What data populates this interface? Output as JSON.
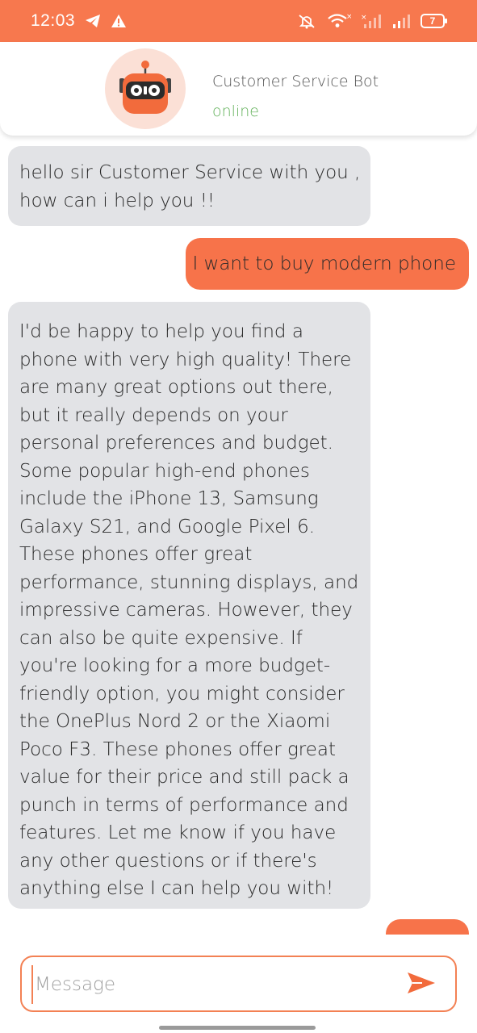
{
  "status_bar": {
    "time": "12:03",
    "battery": "7",
    "icons": [
      "telegram-icon",
      "alert-icon",
      "mute-icon",
      "wifi-icon",
      "signal-icon",
      "signal-icon",
      "battery-icon"
    ]
  },
  "header": {
    "bot_name": "Customer Service Bot",
    "status": "online",
    "avatar_icon": "robot-icon"
  },
  "messages": [
    {
      "sender": "bot",
      "text": "hello sir Customer Service with you , how can i help you !!"
    },
    {
      "sender": "user",
      "text": "I want to buy modern phone"
    },
    {
      "sender": "bot",
      "text": "I'd be happy to help you find a phone with very high quality! There are many great options out there, but it really depends on your personal preferences and budget. Some popular high-end phones include the iPhone 13, Samsung Galaxy S21, and Google Pixel 6. These phones offer great performance, stunning displays, and impressive cameras. However, they can also be quite expensive. If you're looking for a more budget-friendly option, you might consider the OnePlus Nord 2 or the Xiaomi Poco F3. These phones offer great value for their price and still pack a punch in terms of performance and features. Let me know if you have any other questions or if there's anything else I can help you with!"
    },
    {
      "sender": "user",
      "text": ""
    }
  ],
  "composer": {
    "placeholder": "Message",
    "value": "",
    "send_icon": "send-icon"
  },
  "colors": {
    "accent": "#f7784e",
    "user_bubble": "#f7734a",
    "bot_bubble": "#e2e3e6",
    "online": "#62b15a"
  }
}
